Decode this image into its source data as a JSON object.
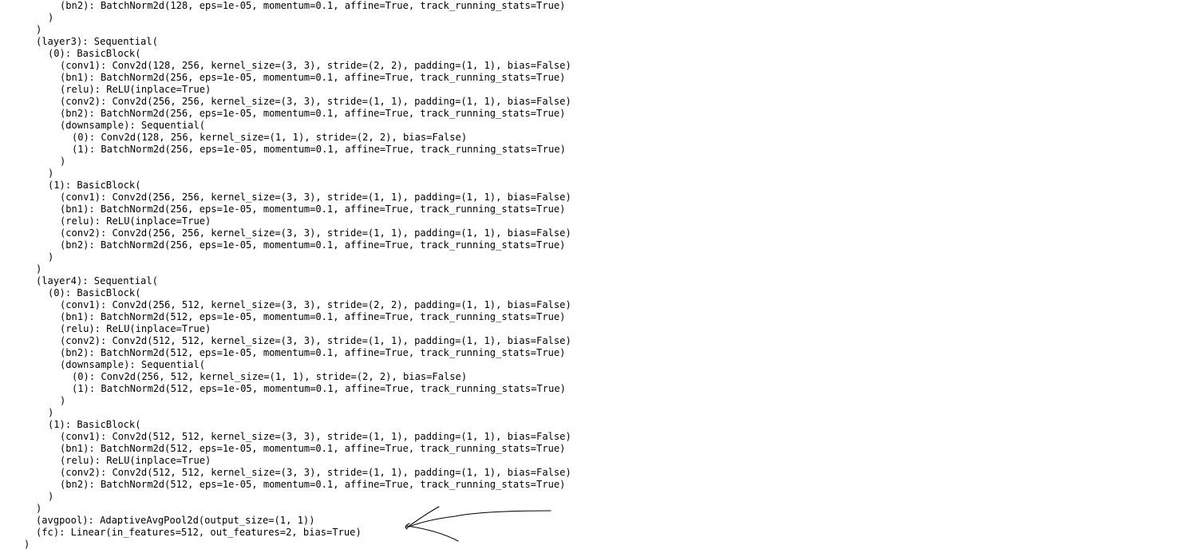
{
  "output": {
    "lines": [
      "(bn2): BatchNorm2d(128, eps=1e-05, momentum=0.1, affine=True, track_running_stats=True)",
      ")",
      ")",
      "(layer3): Sequential(",
      "(0): BasicBlock(",
      "(conv1): Conv2d(128, 256, kernel_size=(3, 3), stride=(2, 2), padding=(1, 1), bias=False)",
      "(bn1): BatchNorm2d(256, eps=1e-05, momentum=0.1, affine=True, track_running_stats=True)",
      "(relu): ReLU(inplace=True)",
      "(conv2): Conv2d(256, 256, kernel_size=(3, 3), stride=(1, 1), padding=(1, 1), bias=False)",
      "(bn2): BatchNorm2d(256, eps=1e-05, momentum=0.1, affine=True, track_running_stats=True)",
      "(downsample): Sequential(",
      "(0): Conv2d(128, 256, kernel_size=(1, 1), stride=(2, 2), bias=False)",
      "(1): BatchNorm2d(256, eps=1e-05, momentum=0.1, affine=True, track_running_stats=True)",
      ")",
      ")",
      "(1): BasicBlock(",
      "(conv1): Conv2d(256, 256, kernel_size=(3, 3), stride=(1, 1), padding=(1, 1), bias=False)",
      "(bn1): BatchNorm2d(256, eps=1e-05, momentum=0.1, affine=True, track_running_stats=True)",
      "(relu): ReLU(inplace=True)",
      "(conv2): Conv2d(256, 256, kernel_size=(3, 3), stride=(1, 1), padding=(1, 1), bias=False)",
      "(bn2): BatchNorm2d(256, eps=1e-05, momentum=0.1, affine=True, track_running_stats=True)",
      ")",
      ")",
      "(layer4): Sequential(",
      "(0): BasicBlock(",
      "(conv1): Conv2d(256, 512, kernel_size=(3, 3), stride=(2, 2), padding=(1, 1), bias=False)",
      "(bn1): BatchNorm2d(512, eps=1e-05, momentum=0.1, affine=True, track_running_stats=True)",
      "(relu): ReLU(inplace=True)",
      "(conv2): Conv2d(512, 512, kernel_size=(3, 3), stride=(1, 1), padding=(1, 1), bias=False)",
      "(bn2): BatchNorm2d(512, eps=1e-05, momentum=0.1, affine=True, track_running_stats=True)",
      "(downsample): Sequential(",
      "(0): Conv2d(256, 512, kernel_size=(1, 1), stride=(2, 2), bias=False)",
      "(1): BatchNorm2d(512, eps=1e-05, momentum=0.1, affine=True, track_running_stats=True)",
      ")",
      ")",
      "(1): BasicBlock(",
      "(conv1): Conv2d(512, 512, kernel_size=(3, 3), stride=(1, 1), padding=(1, 1), bias=False)",
      "(bn1): BatchNorm2d(512, eps=1e-05, momentum=0.1, affine=True, track_running_stats=True)",
      "(relu): ReLU(inplace=True)",
      "(conv2): Conv2d(512, 512, kernel_size=(3, 3), stride=(1, 1), padding=(1, 1), bias=False)",
      "(bn2): BatchNorm2d(512, eps=1e-05, momentum=0.1, affine=True, track_running_stats=True)",
      ")",
      ")",
      "(avgpool): AdaptiveAvgPool2d(output_size=(1, 1))",
      "(fc): Linear(in_features=512, out_features=2, bias=True)",
      ")"
    ]
  },
  "annotation": {
    "type": "hand-drawn-arrow",
    "points_to": "avgpool",
    "color": "#000000"
  },
  "colors": {
    "background": "#ffffff",
    "text": "#000000"
  }
}
